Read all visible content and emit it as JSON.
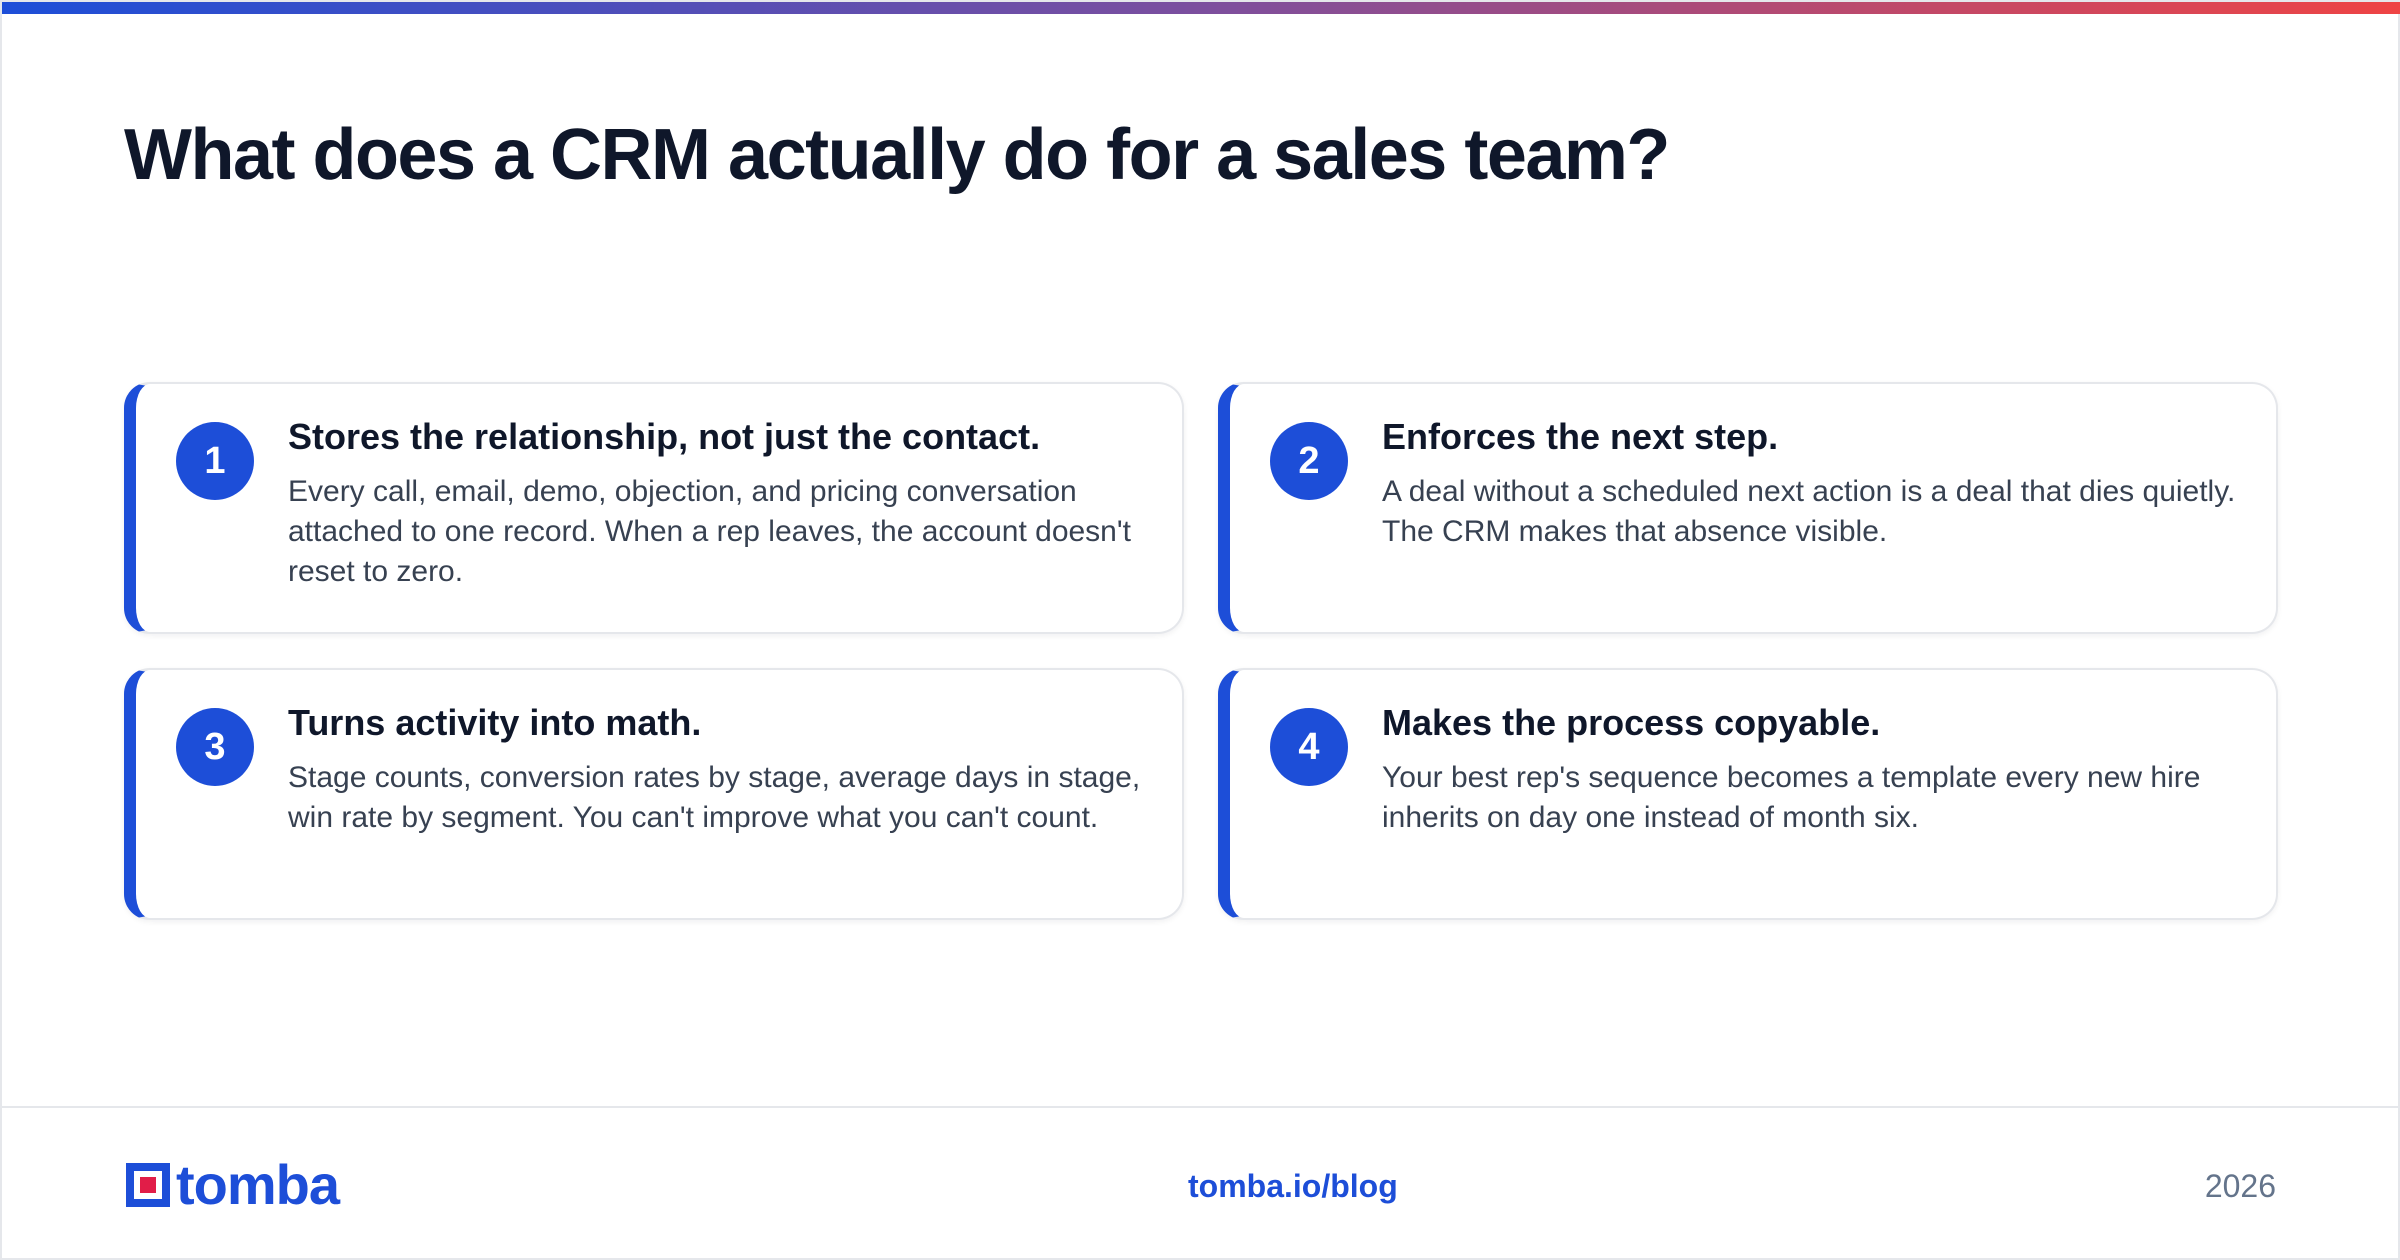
{
  "colors": {
    "accent": "#1d4ed8",
    "title": "#0f172a",
    "body_text": "#374151",
    "muted": "#64748b",
    "gradient_start": "#1d4ed8",
    "gradient_end": "#ef4444",
    "logo_red": "#e11d48"
  },
  "header": {
    "title": "What does a CRM actually do for a sales team?"
  },
  "cards": [
    {
      "number": "1",
      "title": "Stores the relationship, not just the contact.",
      "body": "Every call, email, demo, objection, and pricing conversation attached to one record. When a rep leaves, the account doesn't reset to zero."
    },
    {
      "number": "2",
      "title": "Enforces the next step.",
      "body": "A deal without a scheduled next action is a deal that dies quietly. The CRM makes that absence visible."
    },
    {
      "number": "3",
      "title": "Turns activity into math.",
      "body": "Stage counts, conversion rates by stage, average days in stage, win rate by segment. You can't improve what you can't count."
    },
    {
      "number": "4",
      "title": "Makes the process copyable.",
      "body": "Your best rep's sequence becomes a template every new hire inherits on day one instead of month six."
    }
  ],
  "footer": {
    "logo_text": "tomba",
    "logo_icon": "tomba-logo-icon",
    "link": "tomba.io/blog",
    "year": "2026"
  }
}
